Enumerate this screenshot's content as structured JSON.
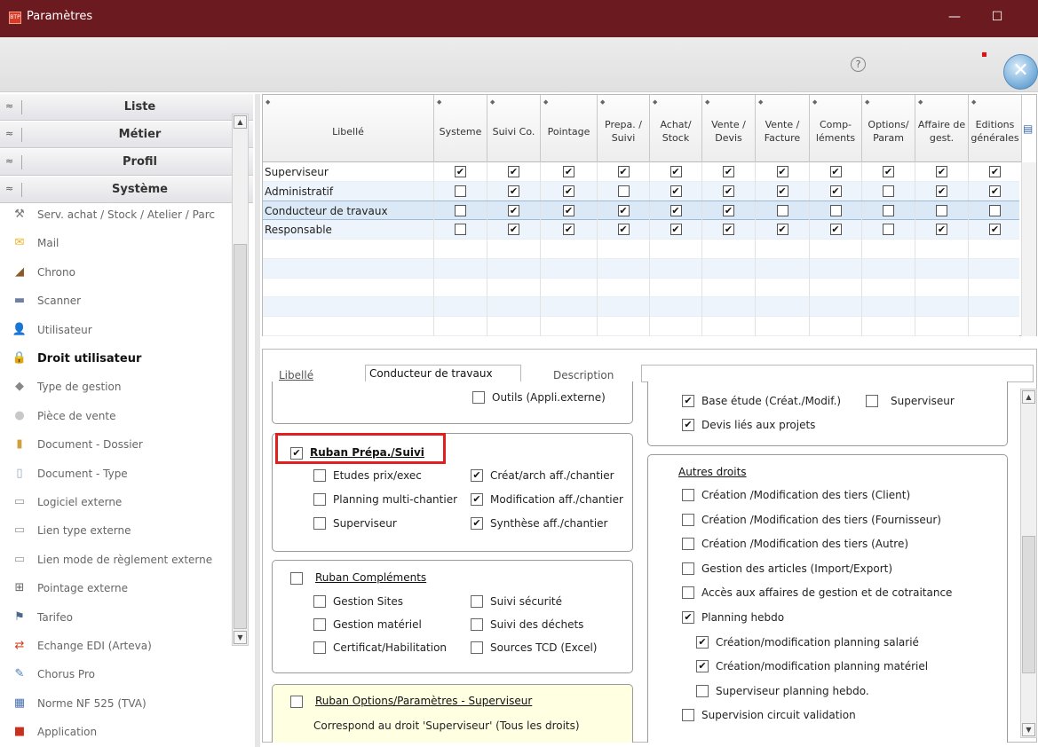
{
  "window": {
    "title": "Paramètres",
    "minimize": "—",
    "maximize": "☐"
  },
  "toolbar": {
    "help": "?",
    "close": "✕"
  },
  "sidebar": {
    "sections": [
      {
        "label": "Liste",
        "chev": "≈"
      },
      {
        "label": "Métier",
        "chev": "≈"
      },
      {
        "label": "Profil",
        "chev": "≈"
      },
      {
        "label": "Système",
        "chev": "≈"
      }
    ],
    "items": [
      {
        "label": "Serv. achat / Stock / Atelier / Parc",
        "icon": "wrench-icon",
        "glyph": "⚒",
        "color": "#7a7a7a"
      },
      {
        "label": "Mail",
        "icon": "mail-icon",
        "glyph": "✉",
        "color": "#f0b020"
      },
      {
        "label": "Chrono",
        "icon": "chrono-icon",
        "glyph": "◢",
        "color": "#8a5a2a"
      },
      {
        "label": "Scanner",
        "icon": "scanner-icon",
        "glyph": "▬",
        "color": "#7080a0"
      },
      {
        "label": "Utilisateur",
        "icon": "user-icon",
        "glyph": "👤",
        "color": "#8a6a40"
      },
      {
        "label": "Droit utilisateur",
        "icon": "lock-icon",
        "glyph": "🔒",
        "color": "#555"
      },
      {
        "label": "Type de gestion",
        "icon": "tag-icon",
        "glyph": "◆",
        "color": "#888"
      },
      {
        "label": "Pièce de vente",
        "icon": "coin-icon",
        "glyph": "●",
        "color": "#c8c8c8"
      },
      {
        "label": "Document - Dossier",
        "icon": "folder-icon",
        "glyph": "▮",
        "color": "#d0a040"
      },
      {
        "label": "Document - Type",
        "icon": "document-icon",
        "glyph": "▯",
        "color": "#9ab"
      },
      {
        "label": "Logiciel externe",
        "icon": "software-icon",
        "glyph": "▭",
        "color": "#999"
      },
      {
        "label": "Lien type externe",
        "icon": "link-icon",
        "glyph": "▭",
        "color": "#999"
      },
      {
        "label": "Lien mode de règlement externe",
        "icon": "payment-link-icon",
        "glyph": "▭",
        "color": "#999"
      },
      {
        "label": "Pointage externe",
        "icon": "clock-icon",
        "glyph": "⊞",
        "color": "#666"
      },
      {
        "label": "Tarifeo",
        "icon": "tarifeo-icon",
        "glyph": "⚑",
        "color": "#4a6a8a"
      },
      {
        "label": "Echange EDI (Arteva)",
        "icon": "exchange-icon",
        "glyph": "⇄",
        "color": "#d04020"
      },
      {
        "label": "Chorus Pro",
        "icon": "chorus-icon",
        "glyph": "✎",
        "color": "#4a7ab0"
      },
      {
        "label": "Norme NF 525 (TVA)",
        "icon": "norm-icon",
        "glyph": "▦",
        "color": "#4a70b0"
      },
      {
        "label": "Application",
        "icon": "application-icon",
        "glyph": "■",
        "color": "#c83020"
      }
    ]
  },
  "grid": {
    "columns": [
      "Libellé",
      "Systeme",
      "Suivi Co.",
      "Pointage",
      "Prepa. / Suivi",
      "Achat/ Stock",
      "Vente / Devis",
      "Vente / Facture",
      "Comp- léments",
      "Options/ Param",
      "Affaire de gest.",
      "Editions générales"
    ],
    "rows": [
      {
        "label": "Superviseur",
        "values": [
          true,
          true,
          true,
          true,
          true,
          true,
          true,
          true,
          true,
          true,
          true
        ]
      },
      {
        "label": "Administratif",
        "values": [
          false,
          true,
          true,
          false,
          true,
          true,
          true,
          true,
          false,
          true,
          true
        ]
      },
      {
        "label": "Conducteur de travaux",
        "values": [
          false,
          true,
          true,
          true,
          true,
          true,
          false,
          false,
          false,
          false,
          false
        ]
      },
      {
        "label": "Responsable",
        "values": [
          false,
          true,
          true,
          true,
          true,
          true,
          true,
          true,
          false,
          true,
          true
        ]
      }
    ]
  },
  "form": {
    "libelle_label": "Libellé",
    "libelle_value": "Conducteur de travaux",
    "description_label": "Description",
    "description_value": "",
    "outils": "Outils (Appli.externe)",
    "prepa": {
      "title": "Ruban Prépa./Suivi",
      "items": [
        {
          "label": "Etudes prix/exec",
          "checked": false
        },
        {
          "label": "Créat/arch aff./chantier",
          "checked": true
        },
        {
          "label": "Planning multi-chantier",
          "checked": false
        },
        {
          "label": "Modification aff./chantier",
          "checked": true
        },
        {
          "label": "Superviseur",
          "checked": false
        },
        {
          "label": "Synthèse aff./chantier",
          "checked": true
        }
      ]
    },
    "complements": {
      "title": "Ruban Compléments",
      "items": [
        {
          "label": "Gestion Sites",
          "checked": false
        },
        {
          "label": "Suivi sécurité",
          "checked": false
        },
        {
          "label": "Gestion matériel",
          "checked": false
        },
        {
          "label": "Suivi des déchets",
          "checked": false
        },
        {
          "label": "Certificat/Habilitation",
          "checked": false
        },
        {
          "label": "Sources TCD (Excel)",
          "checked": false
        }
      ]
    },
    "options": {
      "title": "Ruban Options/Paramètres - Superviseur",
      "note": "Correspond au droit 'Superviseur' (Tous les droits)"
    },
    "etude": {
      "base": "Base étude  (Créat./Modif.)",
      "superviseur": "Superviseur",
      "devis": "Devis liés aux projets"
    },
    "autres": {
      "title": "Autres droits",
      "items": [
        {
          "label": "Création /Modification des tiers (Client)",
          "checked": false,
          "indent": false
        },
        {
          "label": "Création /Modification des tiers (Fournisseur)",
          "checked": false,
          "indent": false
        },
        {
          "label": "Création /Modification des tiers (Autre)",
          "checked": false,
          "indent": false
        },
        {
          "label": "Gestion des articles (Import/Export)",
          "checked": false,
          "indent": false
        },
        {
          "label": "Accès aux affaires de gestion et de cotraitance",
          "checked": false,
          "indent": false
        },
        {
          "label": "Planning hebdo",
          "checked": true,
          "indent": false
        },
        {
          "label": "Création/modification planning salarié",
          "checked": true,
          "indent": true
        },
        {
          "label": "Création/modification planning matériel",
          "checked": true,
          "indent": true
        },
        {
          "label": "Superviseur planning hebdo.",
          "checked": false,
          "indent": true
        },
        {
          "label": "Supervision circuit validation",
          "checked": false,
          "indent": false
        }
      ]
    }
  }
}
